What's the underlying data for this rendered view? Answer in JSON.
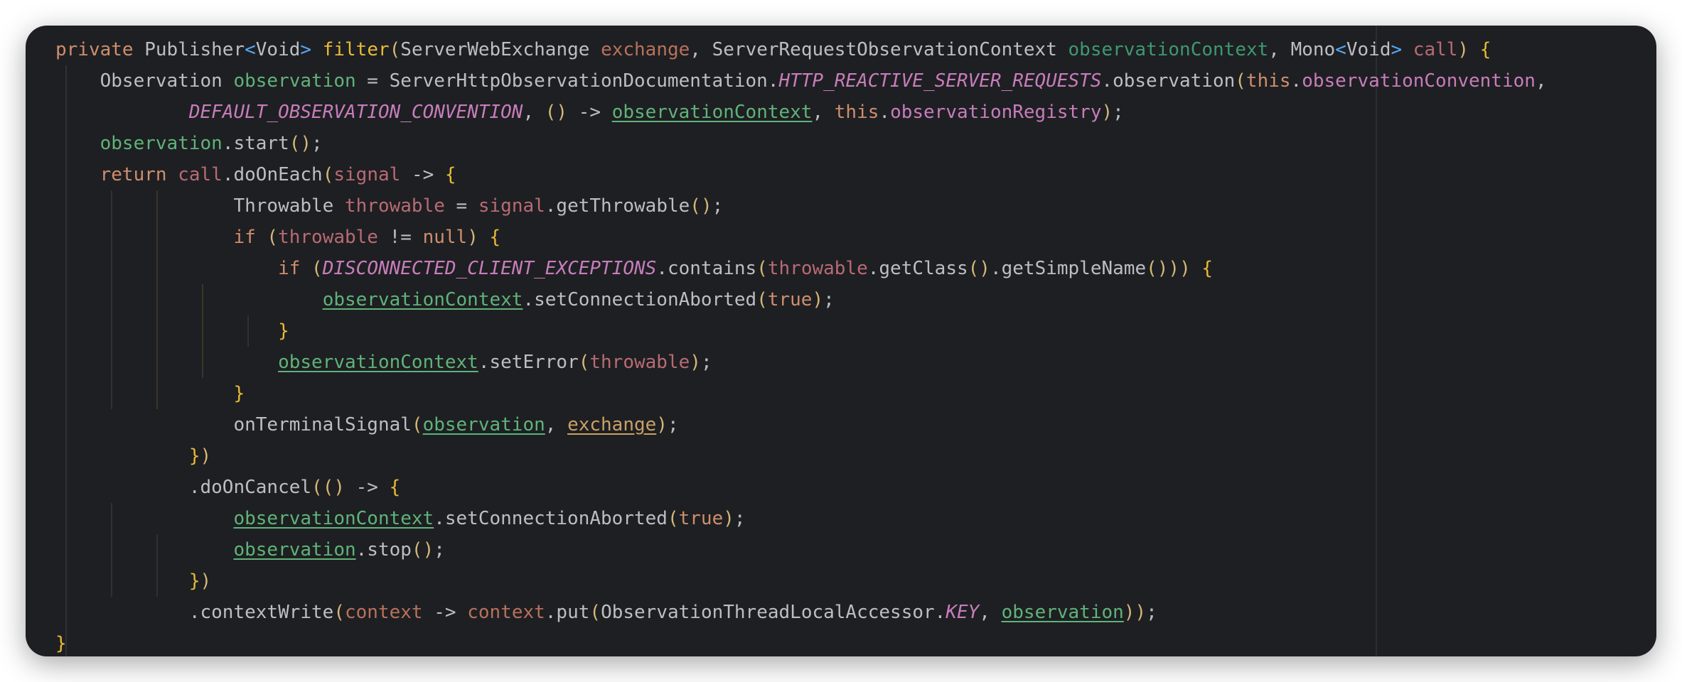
{
  "editor": {
    "theme_background": "#1e1f22",
    "lines": [
      "private Publisher<Void> filter(ServerWebExchange exchange, ServerRequestObservationContext observationContext, Mono<Void> call) {",
      "    Observation observation = ServerHttpObservationDocumentation.HTTP_REACTIVE_SERVER_REQUESTS.observation(this.observationConvention,",
      "            DEFAULT_OBSERVATION_CONVENTION, () -> observationContext, this.observationRegistry);",
      "    observation.start();",
      "    return call.doOnEach(signal -> {",
      "                Throwable throwable = signal.getThrowable();",
      "                if (throwable != null) {",
      "                    if (DISCONNECTED_CLIENT_EXCEPTIONS.contains(throwable.getClass().getSimpleName())) {",
      "                        observationContext.setConnectionAborted(true);",
      "                    }",
      "                    observationContext.setError(throwable);",
      "                }",
      "                onTerminalSignal(observation, exchange);",
      "            })",
      "            .doOnCancel(() -> {",
      "                observationContext.setConnectionAborted(true);",
      "                observation.stop();",
      "            })",
      "            .contextWrite(context -> context.put(ObservationThreadLocalAccessor.KEY, observation));",
      "}"
    ]
  }
}
